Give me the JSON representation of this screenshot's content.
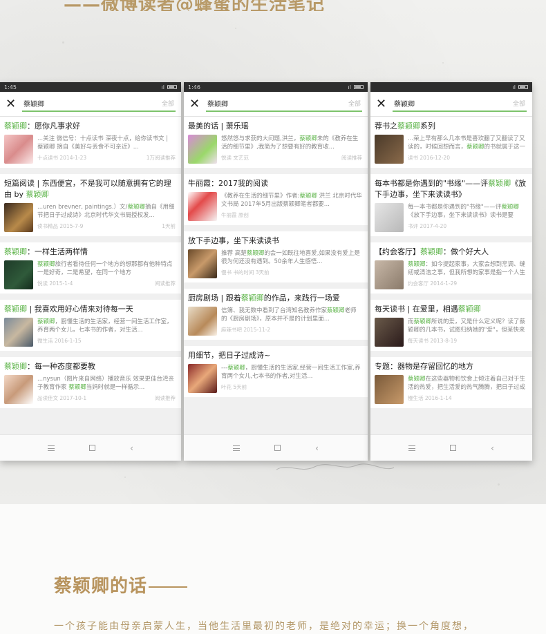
{
  "header": {
    "title": "——微博读者@蜂蜜的生活笔记"
  },
  "phones": [
    {
      "time": "1:45",
      "query": "蔡颖卿",
      "filter": "全部",
      "items": [
        {
          "pre": "",
          "hl": "蔡颖卿",
          "post": "：愿你凡事求好",
          "desc_pre": "...关注 微信号：十点读书 深夜十点，给你读书",
          "desc_hl": "",
          "desc_post": "文 | 蔡颖卿 摘自《美好与丢食不可亲近》...",
          "src": "十点读书 2014-1-23",
          "date": "1万阅读推荐",
          "thumb": "t1"
        },
        {
          "pre": "短篇阅读 | 东西便宜，不是我可以随意拥有它的理由 by ",
          "hl": "蔡颖卿",
          "post": "",
          "desc_pre": "...uren brevner, paintings.）文/",
          "desc_hl": "蔡颖卿",
          "desc_post": "摘自《用细节把日子过成诗》北京时代华文书局授权发...",
          "src": "读书精品 2015-7-9",
          "date": "1天前",
          "thumb": "t2"
        },
        {
          "pre": "",
          "hl": "蔡颖卿",
          "post": "：一样生活两样情",
          "desc_pre": "",
          "desc_hl": "蔡颖卿",
          "desc_post": "旅行者看待任何一个地方的想那都有他种特点一是好奇，二是希望，在同一个地方",
          "src": "悦读 2015-1-4",
          "date": "阅读推荐",
          "thumb": "t3"
        },
        {
          "pre": "",
          "hl": "蔡颖卿",
          "post": " | 我喜欢用好心情来对待每一天",
          "desc_pre": "",
          "desc_hl": "蔡颖卿",
          "desc_post": "，厨懂生活的生活家，经营一间生活工作室，养育两个女儿，七本书的作者，对生活...",
          "src": "微生活 2016-1-15",
          "date": "",
          "thumb": "t4"
        },
        {
          "pre": "",
          "hl": "蔡颖卿",
          "post": "：每一种态度都要教",
          "desc_pre": "...nysun（图片来自网络）播放音乐 效果更佳台湾亲子教育作家 ",
          "desc_hl": "蔡颖卿",
          "desc_post": "当妈时就是一样循示...",
          "src": "品读佳文 2017-10-1",
          "date": "阅读推荐",
          "thumb": "t5"
        }
      ]
    },
    {
      "time": "1:46",
      "query": "蔡颖卿",
      "filter": "全部",
      "items": [
        {
          "pre": "最美的话 | 萧乐瑶",
          "hl": "",
          "post": "",
          "desc_pre": "悠然悠与求获的大问题,洪兰，",
          "desc_hl": "蔡颖卿",
          "desc_post": "未的《教养在生活的细节里》,我简为了想要有好的教育收...",
          "src": "悦读 文艺范",
          "date": "阅读推荐",
          "thumb": "t6"
        },
        {
          "pre": "牛丽霞：2017我的阅读",
          "hl": "",
          "post": "",
          "desc_pre": "《教养在生活的细节里》作者:",
          "desc_hl": "蔡颖卿",
          "desc_post": " 洪兰 北京时代华文书局 2017年5月出版蔡颖卿笔者都要...",
          "src": "牛丽霞 原创",
          "date": "",
          "thumb": "t7"
        },
        {
          "pre": "放下手边事，坐下来读读书",
          "hl": "",
          "post": "",
          "desc_pre": "推荐 高楚",
          "desc_hl": "蔡颖卿",
          "desc_post": "的会一如既往地喜爱,如果没有爱上是很为何还没有遇到。50余年人生感悟...",
          "src": "慢书 书的时间 3天前",
          "date": "",
          "thumb": "t8"
        },
        {
          "pre": "厨房剧场 | 跟着",
          "hl": "蔡颖卿",
          "post": "的作品，来践行一场爱",
          "desc_pre": "信簿、我无数中看到了台湾知名教养作家",
          "desc_hl": "蔡颖卿",
          "desc_post": "老师的《厨房剧场》，原本并不是的计划里面...",
          "src": "麻辣书吧 2015-11-2",
          "date": "",
          "thumb": "t9"
        },
        {
          "pre": "用细节，把日子过成诗~",
          "hl": "",
          "post": "",
          "desc_pre": "---",
          "desc_hl": "蔡颖卿",
          "desc_post": "，厨懂生活的生活家,经营一间生活工作室,养育两个女儿,七本书的作者,对生活...",
          "src": "叶花 5天前",
          "date": "",
          "thumb": "t10"
        }
      ]
    },
    {
      "time": "",
      "query": "蔡颖卿",
      "filter": "全部",
      "items": [
        {
          "pre": "荐书之",
          "hl": "蔡颖卿",
          "post": "系列",
          "desc_pre": "...荣上早有那么几本书是喜欢翻了又翻读了又读的，时候回想而言，",
          "desc_hl": "蔡颖卿",
          "desc_post": "的书就属于这一种...",
          "src": "读书 2016-12-20",
          "date": "",
          "thumb": "t11"
        },
        {
          "pre": "每本书都是你遇到的\"书缘\"——评",
          "hl": "蔡颖卿",
          "post": "《放下手边事，坐下来读读书》",
          "desc_pre": "每一本书都是你遇到的\"书缘\"——评",
          "desc_hl": "蔡颖卿",
          "desc_post": "《放下手边事，坐下来读读书》读书是要讲\"书...",
          "src": "书评 2017-4-20",
          "date": "",
          "thumb": "t12"
        },
        {
          "pre": "【约会客厅】",
          "hl": "蔡颖卿",
          "post": "：做个好大人",
          "desc_pre": "",
          "desc_hl": "蔡颖卿",
          "desc_post": "：如今提起家事，大家会想到烹调、缝纫或清洁之事，但我所想的家事是指一个人生活...",
          "src": "约会客厅 2014-1-29",
          "date": "",
          "thumb": "t13"
        },
        {
          "pre": "每天读书 | 在爱里，相遇",
          "hl": "蔡颖卿",
          "post": "",
          "desc_pre": "而",
          "desc_hl": "蔡颖卿",
          "desc_post": "所说的爱，又是什么定义呢？读了蔡颖卿的几本书，试图归纳她的\"爱\"，但某快来找...",
          "src": "每天读书 2013-8-19",
          "date": "",
          "thumb": "t14"
        },
        {
          "pre": "专题：器物是存留回忆的地方",
          "hl": "",
          "post": "",
          "desc_pre": "",
          "desc_hl": "蔡颖卿",
          "desc_post": "在这些器物和饮食上倾注着自己对于生活的热爱，把生活爱的热气腾腾，把日子过成一...",
          "src": "慢生活 2016-1-14",
          "date": "",
          "thumb": "t15"
        }
      ]
    }
  ],
  "section": {
    "title": "蔡颖卿的话"
  },
  "intro": "一个孩子能由母亲启蒙人生，当他生活里最初的老师，是绝对的幸运；换一个角度想，",
  "icons": [
    "close-icon",
    "menu-icon",
    "home-icon",
    "back-icon",
    "battery-icon"
  ],
  "colors": {
    "accent_green": "#5bb347",
    "gold_text": "#b8945e",
    "status_bar": "#2d2d2d"
  }
}
